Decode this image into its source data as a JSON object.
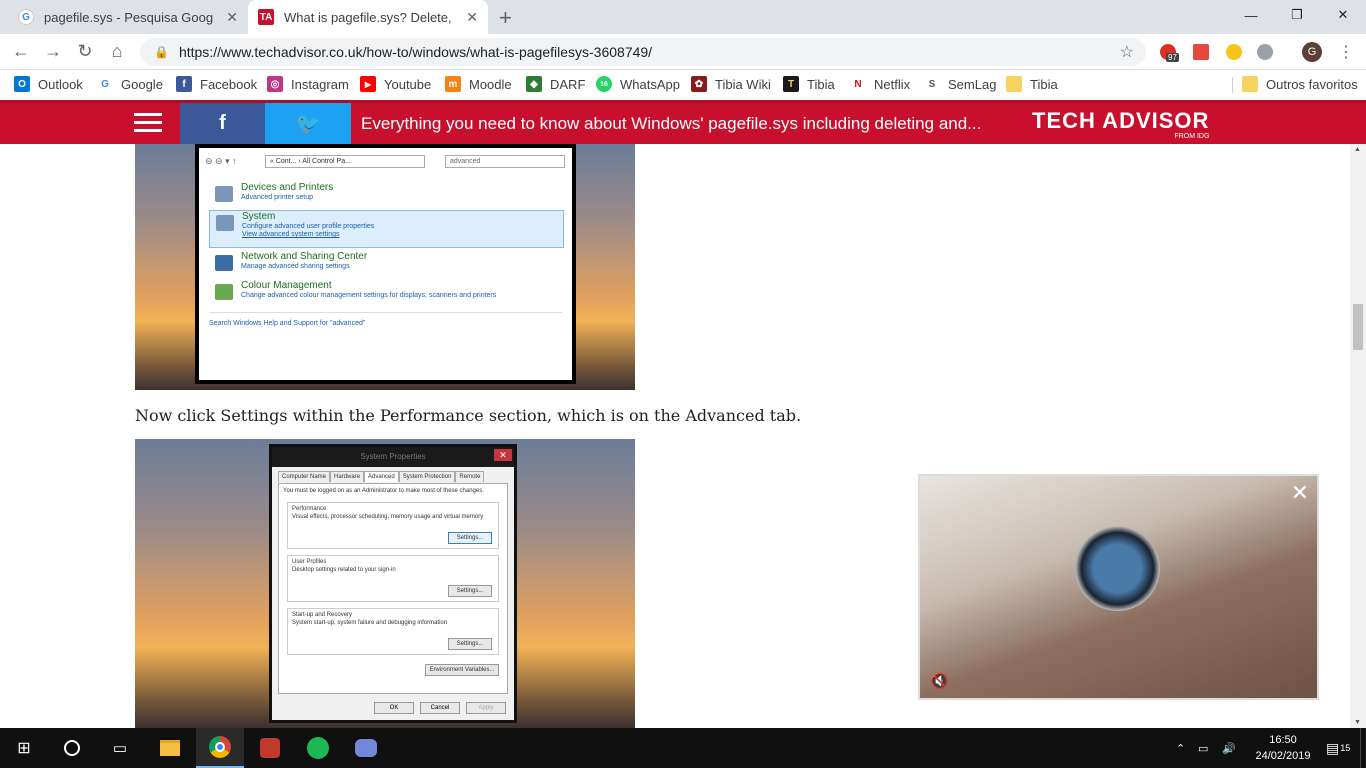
{
  "tabs": [
    {
      "title": "pagefile.sys - Pesquisa Google",
      "favicon": "google-icon"
    },
    {
      "title": "What is pagefile.sys? Delete, Mov",
      "favicon": "techadvisor-icon"
    }
  ],
  "window": {
    "minimize": "—",
    "maximize": "❐",
    "close": "✕"
  },
  "address": {
    "url": "https://www.techadvisor.co.uk/how-to/windows/what-is-pagefilesys-3608749/"
  },
  "extensions": {
    "badge": "97",
    "profile_letter": "G"
  },
  "bookmarks": [
    {
      "label": "Outlook",
      "color": "#0078d4",
      "glyph": "O"
    },
    {
      "label": "Google",
      "color": "#4285f4",
      "glyph": "G"
    },
    {
      "label": "Facebook",
      "color": "#3b5998",
      "glyph": "f"
    },
    {
      "label": "Instagram",
      "color": "#c13584",
      "glyph": "◎"
    },
    {
      "label": "Youtube",
      "color": "#ff0000",
      "glyph": "▶"
    },
    {
      "label": "Moodle",
      "color": "#f98012",
      "glyph": "m"
    },
    {
      "label": "DARF",
      "color": "#2e7d32",
      "glyph": "◆"
    },
    {
      "label": "WhatsApp",
      "color": "#25d366",
      "glyph": "16"
    },
    {
      "label": "Tibia Wiki",
      "color": "#8b1a1a",
      "glyph": "✿"
    },
    {
      "label": "Tibia",
      "color": "#1a1a1a",
      "glyph": "T"
    },
    {
      "label": "Netflix",
      "color": "#e50914",
      "glyph": "N"
    },
    {
      "label": "SemLag",
      "color": "#555555",
      "glyph": "S"
    },
    {
      "label": "Tibia",
      "color": "#f4d35e",
      "glyph": ""
    }
  ],
  "other_bookmarks": "Outros favoritos",
  "site": {
    "facebook": "f",
    "twitter": "🐦",
    "headline": "Everything you need to know about Windows' pagefile.sys including deleting and...",
    "logo": "TECH ADVISOR",
    "logo_sub": "FROM IDG"
  },
  "control_panel": {
    "breadcrumb": "« Cont... › All Control Pa...",
    "search": "advanced",
    "items": [
      {
        "title": "Devices and Printers",
        "sub": "Advanced printer setup",
        "sub2": ""
      },
      {
        "title": "System",
        "sub": "Configure advanced user profile properties",
        "sub2": "View advanced system settings"
      },
      {
        "title": "Network and Sharing Center",
        "sub": "Manage advanced sharing settings",
        "sub2": ""
      },
      {
        "title": "Colour Management",
        "sub": "Change advanced colour management settings for displays, scanners and printers",
        "sub2": ""
      }
    ],
    "help": "Search Windows Help and Support for \"advanced\""
  },
  "caption": "Now click Settings within the Performance section, which is on the Advanced tab.",
  "system_properties": {
    "title": "System Properties",
    "tabs": [
      "Computer Name",
      "Hardware",
      "Advanced",
      "System Protection",
      "Remote"
    ],
    "notice": "You must be logged on as an Administrator to make most of these changes.",
    "groups": [
      {
        "title": "Performance",
        "desc": "Visual effects, processor scheduling, memory usage and virtual memory",
        "button": "Settings..."
      },
      {
        "title": "User Profiles",
        "desc": "Desktop settings related to your sign-in",
        "button": "Settings..."
      },
      {
        "title": "Start-up and Recovery",
        "desc": "System start-up, system failure and debugging information",
        "button": "Settings..."
      }
    ],
    "env_button": "Environment Variables...",
    "ok": "OK",
    "cancel": "Cancel",
    "apply": "Apply"
  },
  "video": {
    "close": "✕",
    "mute": "🔇"
  },
  "taskbar": {
    "time": "16:50",
    "date": "24/02/2019",
    "notifications": "15"
  }
}
